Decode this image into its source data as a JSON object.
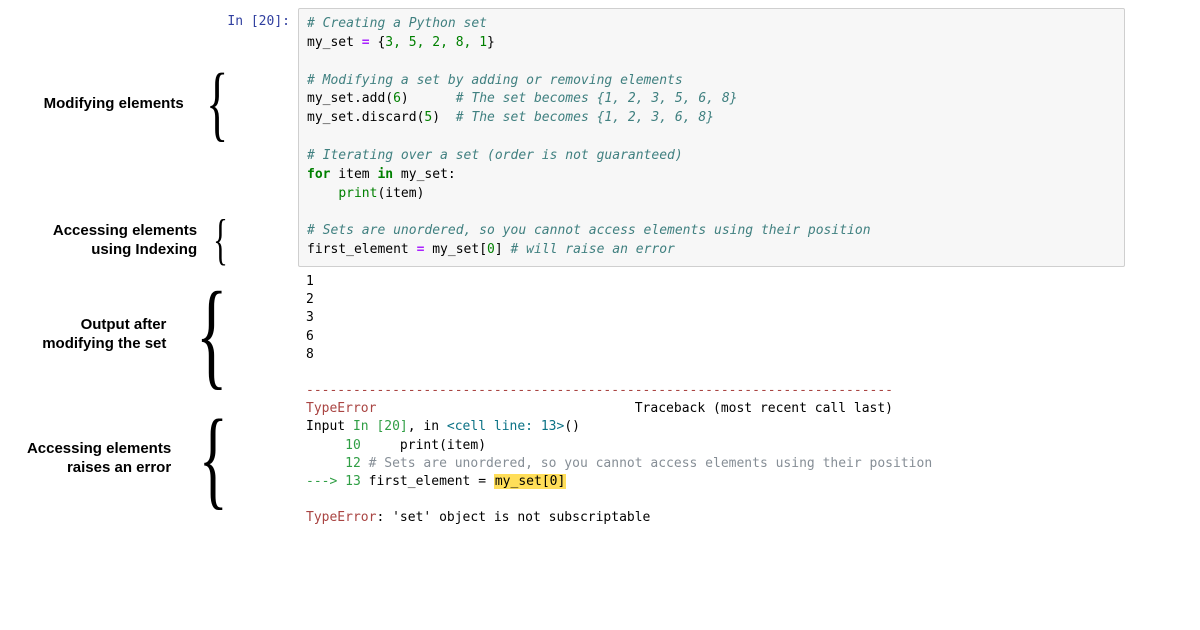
{
  "prompt": "In [20]:",
  "annotations": {
    "modifying": "Modifying elements",
    "indexing_l1": "Accessing elements",
    "indexing_l2": "using Indexing",
    "output_l1": "Output after",
    "output_l2": "modifying the set",
    "error_l1": "Accessing elements",
    "error_l2": "raises an error"
  },
  "code": {
    "l1": "# Creating a Python set",
    "l2a": "my_set ",
    "l2op": "=",
    "l2b": " {",
    "l2n": "3, 5, 2, 8, 1",
    "l2c": "}",
    "l3": "",
    "l4": "# Modifying a set by adding or removing elements",
    "l5a": "my_set.add(",
    "l5n": "6",
    "l5b": ")      ",
    "l5c": "# The set becomes {1, 2, 3, 5, 6, 8}",
    "l6a": "my_set.discard(",
    "l6n": "5",
    "l6b": ")  ",
    "l6c": "# The set becomes {1, 2, 3, 6, 8}",
    "l7": "",
    "l8": "# Iterating over a set (order is not guaranteed)",
    "l9a": "for",
    "l9b": " item ",
    "l9c": "in",
    "l9d": " my_set:",
    "l10a": "    ",
    "l10b": "print",
    "l10c": "(item)",
    "l11": "",
    "l12": "# Sets are unordered, so you cannot access elements using their position",
    "l13a": "first_element ",
    "l13op": "=",
    "l13b": " my_set[",
    "l13n": "0",
    "l13c": "] ",
    "l13d": "# will raise an error"
  },
  "output": {
    "o1": "1",
    "o2": "2",
    "o3": "3",
    "o4": "6",
    "o5": "8"
  },
  "traceback": {
    "sep": "---------------------------------------------------------------------------",
    "head_err": "TypeError",
    "head_rest": "                                 Traceback (most recent call last)",
    "line2a": "Input ",
    "line2b": "In [20]",
    "line2c": ", in ",
    "line2d": "<cell line: 13>",
    "line2e": "()",
    "l10a": "     10",
    "l10b": "     print(item)",
    "l12a": "     12",
    "l12b": " # Sets are unordered, so you cannot access elements using their position",
    "l13arrow": "---> ",
    "l13num": "13",
    "l13a": " first_element = ",
    "l13hl": "my_set[0]",
    "final_err": "TypeError",
    "final_msg": ": 'set' object is not subscriptable"
  }
}
